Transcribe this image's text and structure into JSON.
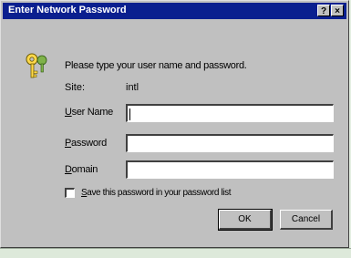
{
  "window": {
    "title": "Enter Network Password",
    "help_glyph": "?",
    "close_glyph": "×"
  },
  "prompt": "Please type your user name and password.",
  "site": {
    "label": "Site:",
    "value": "intl"
  },
  "fields": {
    "user_name": {
      "label_u": "U",
      "label_rest": "ser Name",
      "value": ""
    },
    "password": {
      "label_u": "P",
      "label_rest": "assword",
      "value": ""
    },
    "domain": {
      "label_u": "D",
      "label_rest": "omain",
      "value": ""
    }
  },
  "save_password": {
    "label_u": "S",
    "label_rest": "ave this password in your password list",
    "checked": false
  },
  "buttons": {
    "ok": "OK",
    "cancel": "Cancel"
  },
  "icons": {
    "dialog": "key-icon"
  },
  "colors": {
    "title_bar": "#0a1f8f",
    "dialog_bg": "#c0c0c0"
  }
}
